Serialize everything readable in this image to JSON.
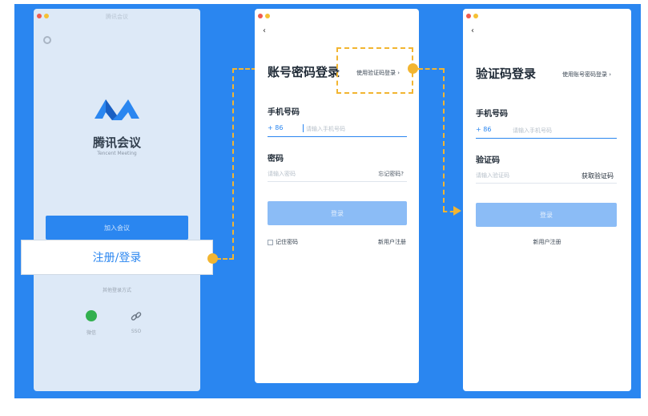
{
  "left_window": {
    "title": "腾讯会议",
    "brand_cn": "腾讯会议",
    "brand_en": "Tencent Meeting",
    "join_button": "加入会议",
    "register_login_button": "注册/登录",
    "other_login": "其他登录方式",
    "options": [
      {
        "label": "微信",
        "icon": "wechat-icon"
      },
      {
        "label": "SSO",
        "icon": "link-icon"
      }
    ]
  },
  "password_login": {
    "back_icon": "‹",
    "heading": "账号密码登录",
    "switch_link": "使用验证码登录 ›",
    "phone_label": "手机号码",
    "country_code": "+ 86",
    "phone_placeholder": "请输入手机号码",
    "password_label": "密码",
    "password_placeholder": "请输入密码",
    "forgot_link": "忘记密码?",
    "login_button": "登录",
    "remember_label": "记住密码",
    "register_link": "新用户注册"
  },
  "code_login": {
    "back_icon": "‹",
    "heading": "验证码登录",
    "switch_link": "使用账号密码登录 ›",
    "phone_label": "手机号码",
    "country_code": "+ 86",
    "phone_placeholder": "请输入手机号码",
    "code_label": "验证码",
    "code_placeholder": "请输入验证码",
    "get_code_button": "获取验证码",
    "login_button": "登录",
    "register_link": "新用户注册"
  },
  "colors": {
    "background": "#2a86f0",
    "accent": "#2a86f0",
    "highlight": "#f2b531",
    "disabled_button": "#8bbcf6"
  }
}
